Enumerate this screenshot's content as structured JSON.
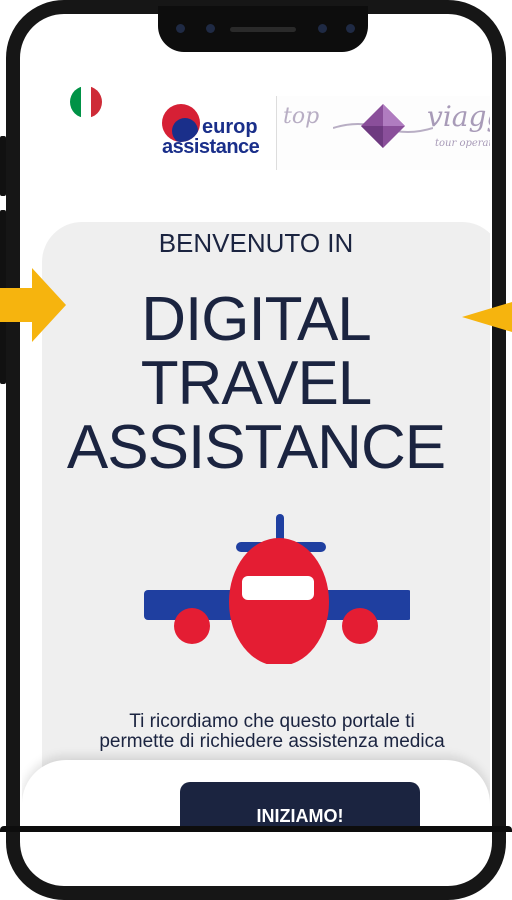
{
  "header": {
    "flag": {
      "country": "italy",
      "colors": [
        "#009246",
        "#ffffff",
        "#ce2b37"
      ]
    },
    "partner_logo": {
      "line1": "europ",
      "line2": "assistance",
      "color": "#1a2f8a",
      "accent": "#d62035"
    },
    "agency_logo": {
      "left_text": "top",
      "right_text": "viaggi",
      "subtitle": "tour operator",
      "color": "#a89bb8"
    }
  },
  "main": {
    "welcome": "BENVENUTO IN",
    "headline_lines": [
      "DIGITAL",
      "TRAVEL",
      "ASSISTANCE"
    ],
    "illustration": "airplane-icon",
    "notice_lines": [
      "Ti ricordiamo che questo portale ti",
      "permette di richiedere assistenza medica"
    ],
    "cta_label": "INIZIAMO!"
  },
  "colors": {
    "navy": "#1b2440",
    "plane_red": "#e41d33",
    "plane_blue": "#1f3fa0",
    "arrow_yellow": "#f6b40e",
    "card_bg": "#efefef"
  }
}
